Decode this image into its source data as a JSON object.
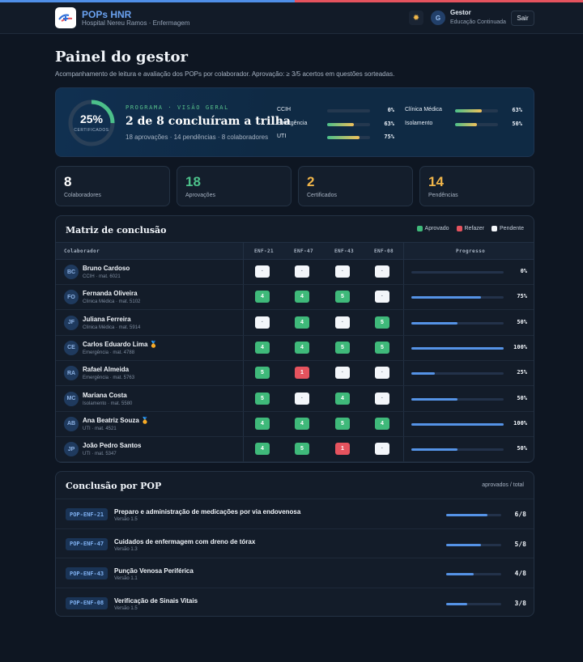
{
  "app": {
    "name": "POPs HNR",
    "subtitle": "Hospital Nereu Ramos · Enfermagem",
    "theme_icon": "sun-icon",
    "user": {
      "initial": "G",
      "name": "Gestor",
      "role": "Educação Continuada"
    },
    "logout_label": "Sair"
  },
  "page": {
    "title": "Painel do gestor",
    "subtitle": "Acompanhamento de leitura e avaliação dos POPs por colaborador. Aprovação: ≥ 3/5 acertos em questões sorteadas."
  },
  "hero": {
    "progress_pct": "25%",
    "progress_value": 0.25,
    "progress_caption": "CERTIFICADOS",
    "eyebrow": "PROGRAMA · VISÃO GERAL",
    "title": "2 de 8 concluíram a trilha",
    "meta": "18 aprovações · 14 pendências · 8 colaboradores",
    "sectors": [
      {
        "name": "CCIH",
        "pct": "0%",
        "value": 0
      },
      {
        "name": "Emergência",
        "pct": "63%",
        "value": 0.63
      },
      {
        "name": "UTI",
        "pct": "75%",
        "value": 0.75
      },
      {
        "name": "Clínica Médica",
        "pct": "63%",
        "value": 0.63
      },
      {
        "name": "Isolamento",
        "pct": "50%",
        "value": 0.5
      }
    ]
  },
  "stats": [
    {
      "value": "8",
      "label": "Colaboradores",
      "color": "#ffffff"
    },
    {
      "value": "18",
      "label": "Aprovações",
      "color": "#4cc08a"
    },
    {
      "value": "2",
      "label": "Certificados",
      "color": "#f0b54a"
    },
    {
      "value": "14",
      "label": "Pendências",
      "color": "#f0b54a"
    }
  ],
  "matrix": {
    "title": "Matriz de conclusão",
    "legend": [
      {
        "label": "Aprovado",
        "color": "#3fb97a"
      },
      {
        "label": "Refazer",
        "color": "#e5535e"
      },
      {
        "label": "Pendente",
        "color": "#f3f6fa"
      }
    ],
    "headers": {
      "collaborator": "Colaborador",
      "pops": [
        "ENF-21",
        "ENF-47",
        "ENF-43",
        "ENF-08"
      ],
      "progress": "Progresso"
    },
    "rows": [
      {
        "initials": "BC",
        "name": "Bruno Cardoso",
        "medal": "",
        "sub": "CCIH · mat. 6021",
        "cells": [
          [
            "pend",
            "·"
          ],
          [
            "pend",
            "·"
          ],
          [
            "pend",
            "·"
          ],
          [
            "pend",
            "·"
          ]
        ],
        "pct": "0%",
        "value": 0
      },
      {
        "initials": "FO",
        "name": "Fernanda Oliveira",
        "medal": "",
        "sub": "Clínica Médica · mat. 5102",
        "cells": [
          [
            "ok",
            "4"
          ],
          [
            "ok",
            "4"
          ],
          [
            "ok",
            "5"
          ],
          [
            "pend",
            "·"
          ]
        ],
        "pct": "75%",
        "value": 0.75
      },
      {
        "initials": "JF",
        "name": "Juliana Ferreira",
        "medal": "",
        "sub": "Clínica Médica · mat. 5914",
        "cells": [
          [
            "pend",
            "·"
          ],
          [
            "ok",
            "4"
          ],
          [
            "pend",
            "·"
          ],
          [
            "ok",
            "5"
          ]
        ],
        "pct": "50%",
        "value": 0.5
      },
      {
        "initials": "CE",
        "name": "Carlos Eduardo Lima",
        "medal": "🏅",
        "sub": "Emergência · mat. 4788",
        "cells": [
          [
            "ok",
            "4"
          ],
          [
            "ok",
            "4"
          ],
          [
            "ok",
            "5"
          ],
          [
            "ok",
            "5"
          ]
        ],
        "pct": "100%",
        "value": 1
      },
      {
        "initials": "RA",
        "name": "Rafael Almeida",
        "medal": "",
        "sub": "Emergência · mat. 5763",
        "cells": [
          [
            "ok",
            "5"
          ],
          [
            "bad",
            "1"
          ],
          [
            "pend",
            "·"
          ],
          [
            "pend",
            "·"
          ]
        ],
        "pct": "25%",
        "value": 0.25
      },
      {
        "initials": "MC",
        "name": "Mariana Costa",
        "medal": "",
        "sub": "Isolamento · mat. 5580",
        "cells": [
          [
            "ok",
            "5"
          ],
          [
            "pend",
            "·"
          ],
          [
            "ok",
            "4"
          ],
          [
            "pend",
            "·"
          ]
        ],
        "pct": "50%",
        "value": 0.5
      },
      {
        "initials": "AB",
        "name": "Ana Beatriz Souza",
        "medal": "🏅",
        "sub": "UTI · mat. 4521",
        "cells": [
          [
            "ok",
            "4"
          ],
          [
            "ok",
            "4"
          ],
          [
            "ok",
            "5"
          ],
          [
            "ok",
            "4"
          ]
        ],
        "pct": "100%",
        "value": 1
      },
      {
        "initials": "JP",
        "name": "João Pedro Santos",
        "medal": "",
        "sub": "UTI · mat. 5347",
        "cells": [
          [
            "ok",
            "4"
          ],
          [
            "ok",
            "5"
          ],
          [
            "bad",
            "1"
          ],
          [
            "pend",
            "·"
          ]
        ],
        "pct": "50%",
        "value": 0.5
      }
    ]
  },
  "pops": {
    "title": "Conclusão por POP",
    "hint": "aprovados / total",
    "items": [
      {
        "code": "POP-ENF-21",
        "title": "Preparo e administração de medicações por via endovenosa",
        "version": "Versão 1.5",
        "count": "6/8",
        "value": 0.75
      },
      {
        "code": "POP-ENF-47",
        "title": "Cuidados de enfermagem com dreno de tórax",
        "version": "Versão 1.3",
        "count": "5/8",
        "value": 0.625
      },
      {
        "code": "POP-ENF-43",
        "title": "Punção Venosa Periférica",
        "version": "Versão 1.1",
        "count": "4/8",
        "value": 0.5
      },
      {
        "code": "POP-ENF-08",
        "title": "Verificação de Sinais Vitais",
        "version": "Versão 1.5",
        "count": "3/8",
        "value": 0.375
      }
    ]
  }
}
